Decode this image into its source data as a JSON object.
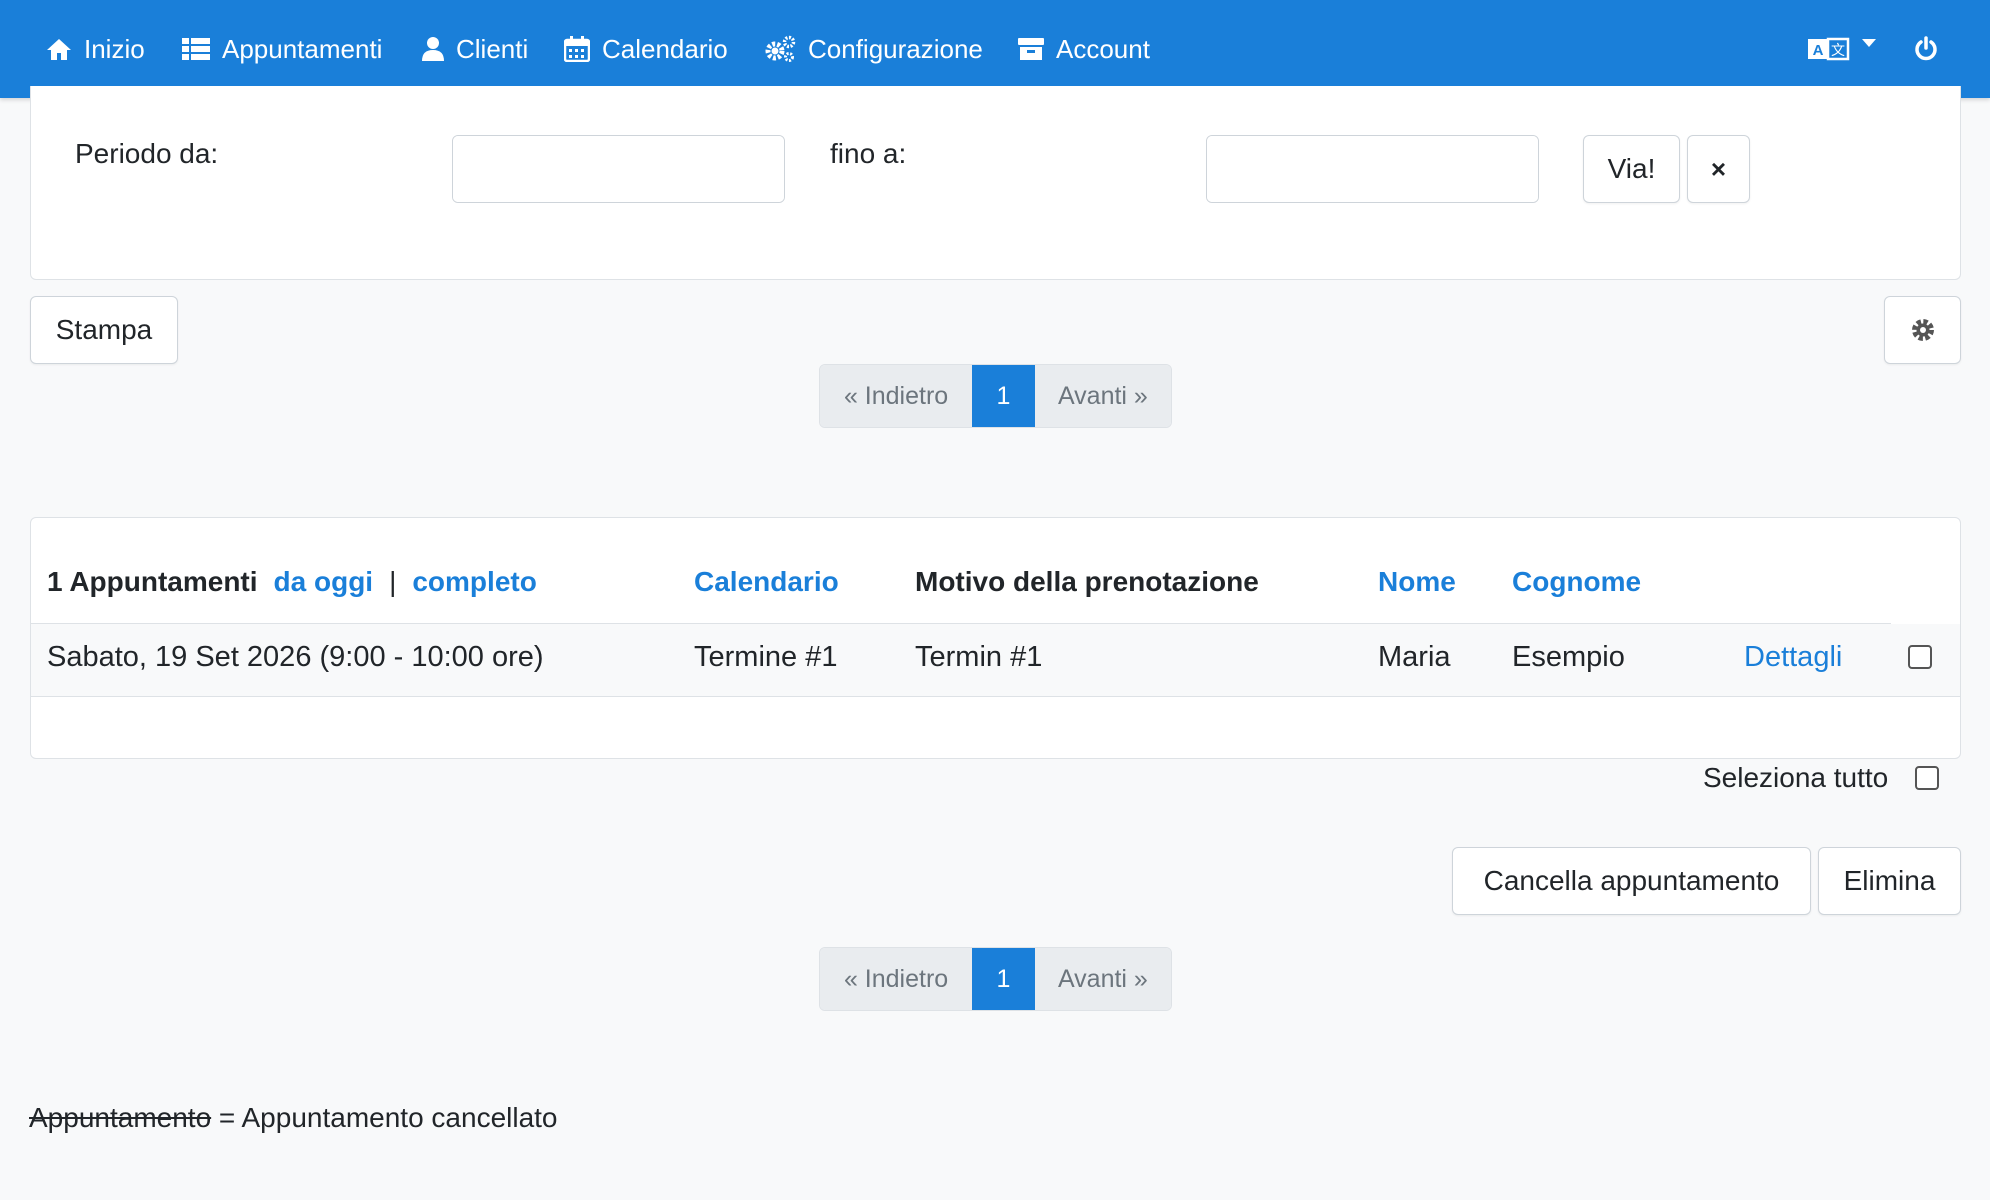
{
  "nav": {
    "items": [
      {
        "label": "Inizio",
        "icon": "home-icon"
      },
      {
        "label": "Appuntamenti",
        "icon": "list-icon"
      },
      {
        "label": "Clienti",
        "icon": "user-icon"
      },
      {
        "label": "Calendario",
        "icon": "calendar-icon"
      },
      {
        "label": "Configurazione",
        "icon": "cogs-icon"
      },
      {
        "label": "Account",
        "icon": "archive-icon"
      }
    ],
    "language_icon": "language-icon",
    "power_icon": "power-icon"
  },
  "filter": {
    "from_label": "Periodo da:",
    "to_label": "fino a:",
    "from_value": "",
    "to_value": "",
    "go_label": "Via!",
    "clear_label": "×"
  },
  "toolbar": {
    "print_label": "Stampa"
  },
  "pagination": {
    "prev_label": "« Indietro",
    "page": "1",
    "next_label": "Avanti »"
  },
  "table": {
    "count_title": "1 Appuntamenti",
    "from_today_link": "da oggi",
    "separator": "|",
    "complete_link": "completo",
    "headers": {
      "calendar": "Calendario",
      "reason": "Motivo della prenotazione",
      "first_name": "Nome",
      "last_name": "Cognome"
    },
    "rows": [
      {
        "date": "Sabato, 19 Set 2026 (9:00 - 10:00 ore)",
        "calendar": "Termine #1",
        "reason": "Termin #1",
        "first_name": "Maria",
        "last_name": "Esempio",
        "details_link": "Dettagli",
        "checked": false
      }
    ]
  },
  "select_all_label": "Seleziona tutto",
  "actions": {
    "cancel_label": "Cancella appuntamento",
    "delete_label": "Elimina"
  },
  "legend": {
    "struck_word": "Appuntamento",
    "explanation": " = Appuntamento cancellato"
  },
  "colors": {
    "primary": "#1a7fd9",
    "background": "#f8f9fa"
  }
}
